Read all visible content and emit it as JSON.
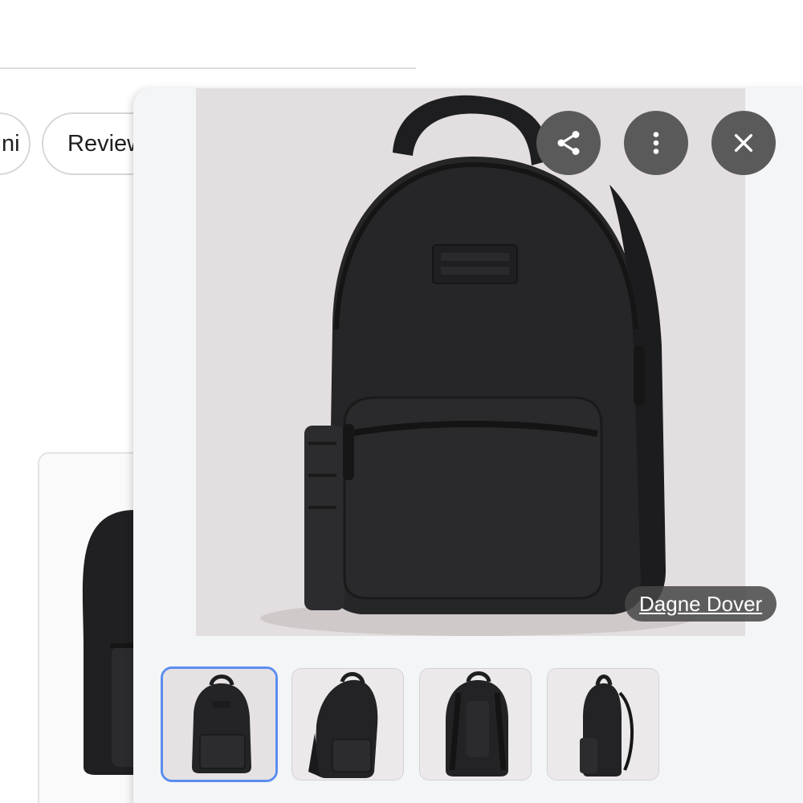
{
  "background_page": {
    "chips": [
      {
        "label": "ni"
      },
      {
        "label": "Reviews"
      }
    ]
  },
  "viewer": {
    "image_alt": "Dagne Dover backpack",
    "source": {
      "label": "Dagne Dover"
    },
    "actions": [
      {
        "icon": "share-icon"
      },
      {
        "icon": "more-vert-icon"
      },
      {
        "icon": "close-icon"
      }
    ],
    "thumbnails": [
      {
        "view": "front",
        "selected": true
      },
      {
        "view": "three-quarter",
        "selected": false
      },
      {
        "view": "back",
        "selected": false
      },
      {
        "view": "side",
        "selected": false
      }
    ]
  },
  "colors": {
    "selected_thumbnail_border": "#5b8def",
    "action_button": "#5a5a5a",
    "image_background": "#e3dedf",
    "backpack": "#232325"
  }
}
